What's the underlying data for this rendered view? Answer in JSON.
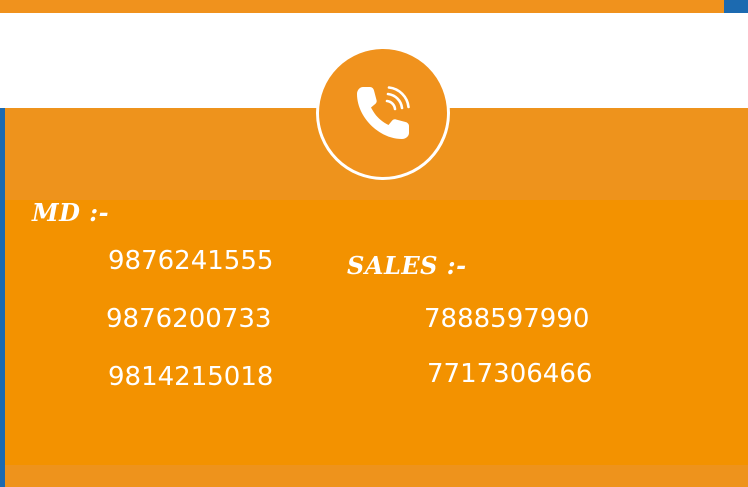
{
  "contact": {
    "icon": "phone-ringing-icon",
    "md": {
      "heading": "MD :-",
      "numbers": [
        "9876241555",
        "9876200733",
        "9814215018"
      ]
    },
    "sales": {
      "heading": "SALES :-",
      "numbers": [
        "7888597990",
        "7717306466"
      ]
    }
  },
  "colors": {
    "orange": "#f39200",
    "orange_light": "#ee931c",
    "blue_accent": "#1c6ab0",
    "white": "#ffffff"
  }
}
